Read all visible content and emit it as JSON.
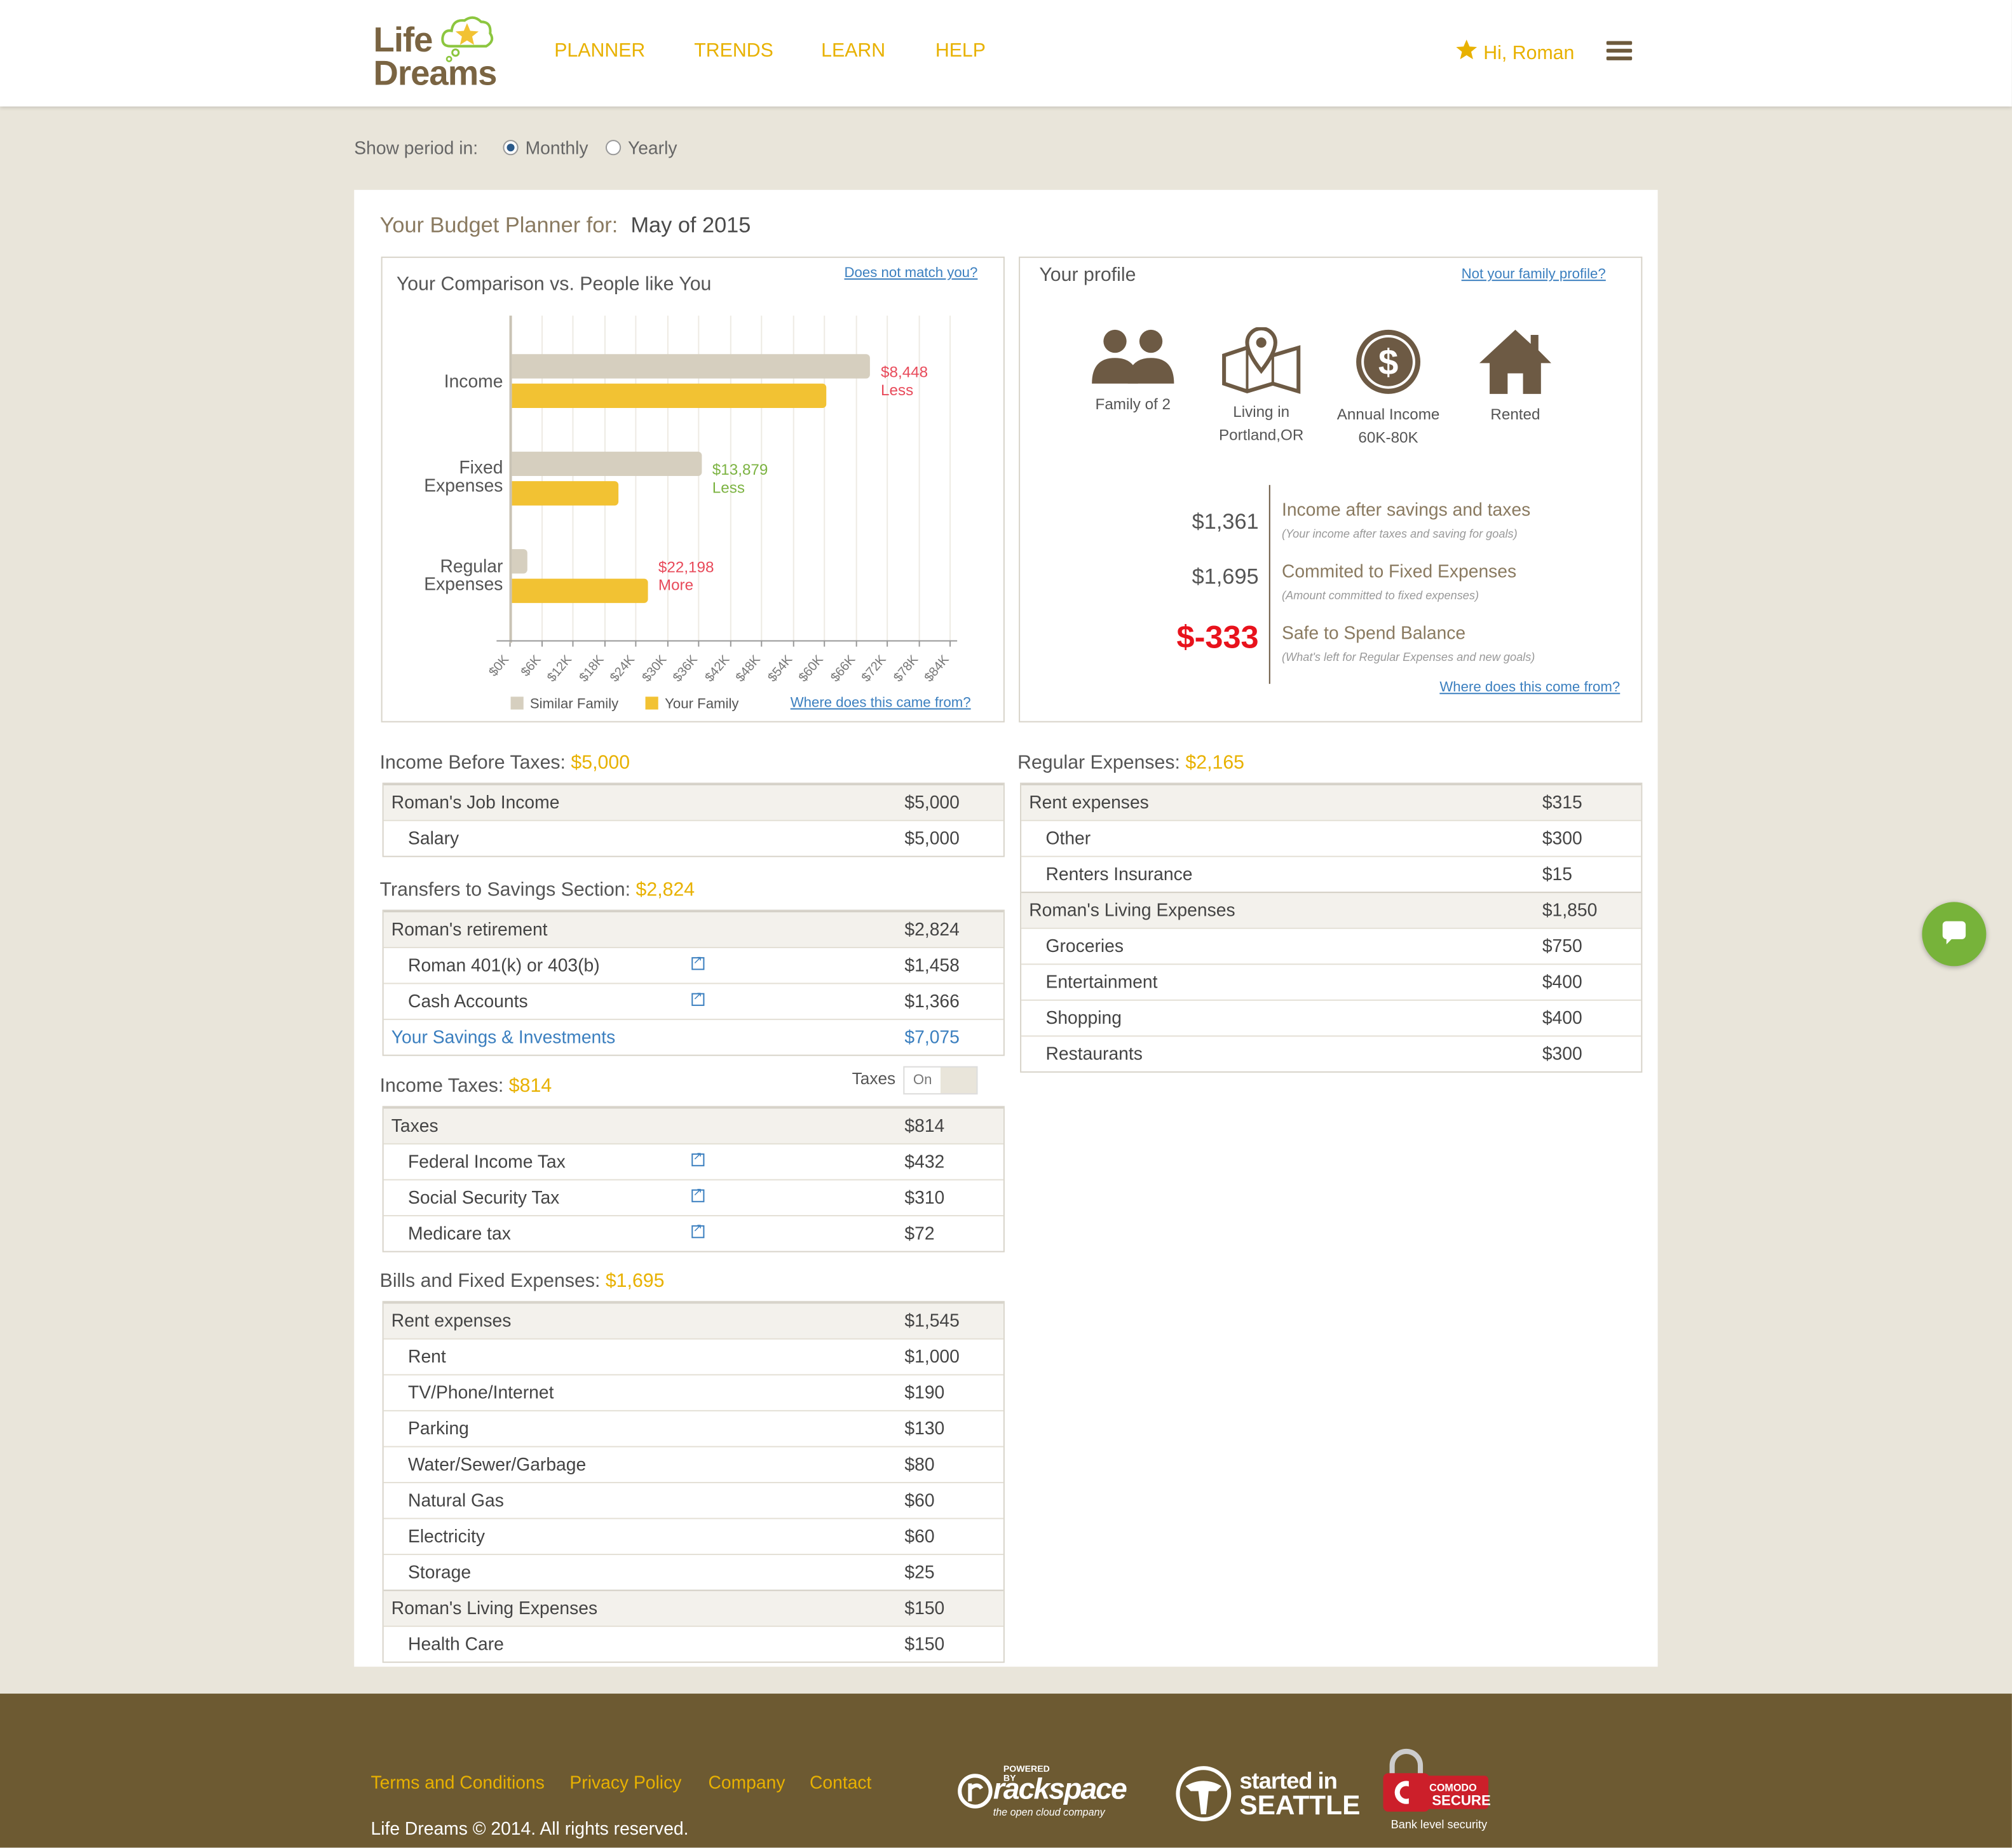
{
  "brand": {
    "line1": "Life",
    "line2": "Dreams"
  },
  "nav": [
    "PLANNER",
    "TRENDS",
    "LEARN",
    "HELP"
  ],
  "user": {
    "greeting": "Hi, Roman"
  },
  "period": {
    "label": "Show period in:",
    "monthly": "Monthly",
    "yearly": "Yearly",
    "selected": "Monthly"
  },
  "planner": {
    "title": "Your Budget Planner for:",
    "period": "May of 2015"
  },
  "comparison": {
    "title": "Your Comparison vs. People like You",
    "mismatch_link": "Does not match you?",
    "source_link": "Where does this came from?",
    "legend": [
      "Similar Family",
      "Your Family"
    ],
    "diffs": [
      {
        "amount": "$8,448",
        "word": "Less",
        "color": "#e84a5a"
      },
      {
        "amount": "$13,879",
        "word": "Less",
        "color": "#7cb342"
      },
      {
        "amount": "$22,198",
        "word": "More",
        "color": "#e84a5a"
      }
    ]
  },
  "chart_data": {
    "type": "bar",
    "orientation": "horizontal",
    "categories": [
      "Income",
      "Fixed Expenses",
      "Regular Expenses"
    ],
    "series": [
      {
        "name": "Similar Family",
        "values": [
          68448,
          36279,
          3000
        ],
        "color": "#d6cfbf"
      },
      {
        "name": "Your Family",
        "values": [
          60000,
          20340,
          25979
        ],
        "color": "#f2c233"
      }
    ],
    "xlim": [
      0,
      84000
    ],
    "ticks": [
      "$0K",
      "$6K",
      "$12K",
      "$18K",
      "$24K",
      "$30K",
      "$36K",
      "$42K",
      "$48K",
      "$54K",
      "$60K",
      "$66K",
      "$72K",
      "$78K",
      "$84K"
    ],
    "grid": true,
    "legend": "bottom"
  },
  "profile": {
    "title": "Your profile",
    "link": "Not your family profile?",
    "items": [
      {
        "icon": "family-icon",
        "line1": "Family of 2",
        "line2": ""
      },
      {
        "icon": "map-pin-icon",
        "line1": "Living in",
        "line2": "Portland,OR"
      },
      {
        "icon": "dollar-coin-icon",
        "line1": "Annual Income",
        "line2": "60K-80K"
      },
      {
        "icon": "house-icon",
        "line1": "Rented",
        "line2": ""
      }
    ],
    "summary": [
      {
        "value": "$1,361",
        "label": "Income after savings and taxes",
        "sub": "(Your income after taxes and saving for goals)"
      },
      {
        "value": "$1,695",
        "label": "Commited to Fixed Expenses",
        "sub": "(Amount committed to fixed expenses)"
      },
      {
        "value": "$-333",
        "label": "Safe to Spend Balance",
        "sub": "(What's left for Regular Expenses and new goals)"
      }
    ],
    "source_link": "Where does this come from?",
    "negative_color": "#e8121c"
  },
  "income": {
    "title": "Income Before Taxes:",
    "amount": "$5,000",
    "rows": [
      {
        "label": "Roman's Job Income",
        "value": "$5,000",
        "type": "hd"
      },
      {
        "label": "Salary",
        "value": "$5,000",
        "type": "ind"
      }
    ]
  },
  "savings": {
    "title": "Transfers to Savings Section:",
    "amount": "$2,824",
    "rows": [
      {
        "label": "Roman's retirement",
        "value": "$2,824",
        "type": "hd"
      },
      {
        "label": "Roman 401(k) or 403(b)",
        "value": "$1,458",
        "type": "ind"
      },
      {
        "label": "Cash Accounts",
        "value": "$1,366",
        "type": "ind"
      },
      {
        "label": "Your Savings & Investments",
        "value": "$7,075",
        "type": "blue"
      }
    ]
  },
  "taxes": {
    "title": "Income Taxes:",
    "amount": "$814",
    "toggle_label": "Taxes",
    "toggle_state": "On",
    "rows": [
      {
        "label": "Taxes",
        "value": "$814",
        "type": "hd"
      },
      {
        "label": "Federal Income Tax",
        "value": "$432",
        "type": "ind"
      },
      {
        "label": "Social Security Tax",
        "value": "$310",
        "type": "ind"
      },
      {
        "label": "Medicare tax",
        "value": "$72",
        "type": "ind"
      }
    ]
  },
  "bills": {
    "title": "Bills and Fixed Expenses:",
    "amount": "$1,695",
    "rows": [
      {
        "label": "Rent expenses",
        "value": "$1,545",
        "type": "hd"
      },
      {
        "label": "Rent",
        "value": "$1,000",
        "type": "ind"
      },
      {
        "label": "TV/Phone/Internet",
        "value": "$190",
        "type": "ind"
      },
      {
        "label": "Parking",
        "value": "$130",
        "type": "ind"
      },
      {
        "label": "Water/Sewer/Garbage",
        "value": "$80",
        "type": "ind"
      },
      {
        "label": "Natural Gas",
        "value": "$60",
        "type": "ind"
      },
      {
        "label": "Electricity",
        "value": "$60",
        "type": "ind"
      },
      {
        "label": "Storage",
        "value": "$25",
        "type": "ind"
      },
      {
        "label": "Roman's Living Expenses",
        "value": "$150",
        "type": "hd"
      },
      {
        "label": "Health Care",
        "value": "$150",
        "type": "ind"
      }
    ]
  },
  "regular": {
    "title": "Regular Expenses:",
    "amount": "$2,165",
    "rows": [
      {
        "label": "Rent expenses",
        "value": "$315",
        "type": "hd"
      },
      {
        "label": "Other",
        "value": "$300",
        "type": "ind"
      },
      {
        "label": "Renters Insurance",
        "value": "$15",
        "type": "ind"
      },
      {
        "label": "Roman's Living Expenses",
        "value": "$1,850",
        "type": "hd"
      },
      {
        "label": "Groceries",
        "value": "$750",
        "type": "ind"
      },
      {
        "label": "Entertainment",
        "value": "$400",
        "type": "ind"
      },
      {
        "label": "Shopping",
        "value": "$400",
        "type": "ind"
      },
      {
        "label": "Restaurants",
        "value": "$300",
        "type": "ind"
      }
    ]
  },
  "footer": {
    "links": [
      "Terms and Conditions",
      "Privacy Policy",
      "Company",
      "Contact"
    ],
    "copyright": "Life Dreams © 2014. All rights reserved.",
    "badges": {
      "rackspace_top": "POWERED BY",
      "rackspace": "rackspace",
      "rackspace_sub": "the open cloud company",
      "seattle1": "started in",
      "seattle2": "SEATTLE",
      "comodo1": "COMODO",
      "comodo2": "SECURE",
      "comodo_sub": "Bank level security"
    }
  },
  "colors": {
    "accent": "#e8b100",
    "brown": "#6d5a32",
    "link": "#3b7fbf",
    "chat": "#77b33a"
  }
}
